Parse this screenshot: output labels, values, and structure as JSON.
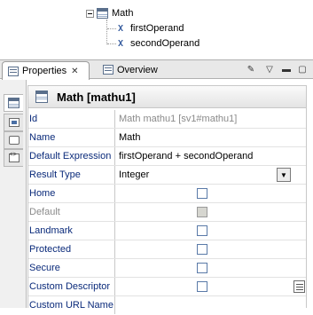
{
  "tree": {
    "root": {
      "label": "Math",
      "icon": "table-icon"
    },
    "children": [
      {
        "label": "firstOperand",
        "icon": "x-variable-icon"
      },
      {
        "label": "secondOperand",
        "icon": "x-variable-icon"
      }
    ]
  },
  "tabs": {
    "properties": "Properties",
    "overview": "Overview"
  },
  "header": {
    "title": "Math [mathu1]"
  },
  "rows": [
    {
      "label": "Id",
      "value": "Math mathu1  [sv1#mathu1]",
      "dim_value": true
    },
    {
      "label": "Name",
      "value": "Math"
    },
    {
      "label": "Default Expression",
      "value": "firstOperand + secondOperand"
    },
    {
      "label": "Result Type",
      "value": "Integer"
    },
    {
      "label": "Home",
      "checked": false
    },
    {
      "label": "Default",
      "checked": false,
      "disabled": true
    },
    {
      "label": "Landmark",
      "checked": false
    },
    {
      "label": "Protected",
      "checked": false
    },
    {
      "label": "Secure",
      "checked": false
    },
    {
      "label": "Custom Descriptor",
      "checked": false
    },
    {
      "label": "Custom URL Name",
      "value": ""
    }
  ],
  "colors": {
    "label_text": "#0a2a7a",
    "dim_text": "#8a8a8a",
    "border": "#c8c8c8"
  }
}
